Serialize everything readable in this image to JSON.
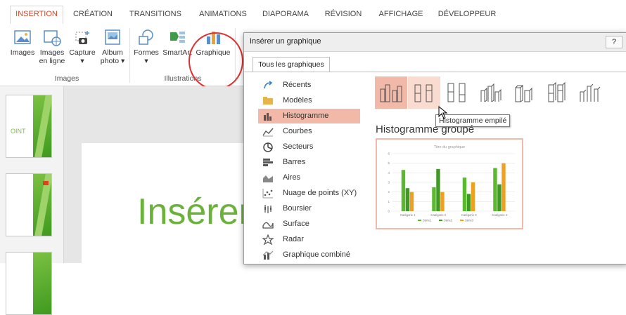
{
  "ribbon_tabs": [
    "INSERTION",
    "CRÉATION",
    "TRANSITIONS",
    "ANIMATIONS",
    "DIAPORAMA",
    "RÉVISION",
    "AFFICHAGE",
    "DÉVELOPPEUR"
  ],
  "ribbon": {
    "buttons": {
      "images": "Images",
      "images_online_1": "Images",
      "images_online_2": "en ligne",
      "capture": "Capture",
      "capture_arrow": "▾",
      "album_1": "Album",
      "album_2": "photo ▾",
      "formes": "Formes",
      "formes_arrow": "▾",
      "smartart": "SmartArt",
      "graphique": "Graphique"
    },
    "groups": {
      "images": "Images",
      "illustrations": "Illustrations"
    }
  },
  "slide": {
    "title": "Insérer"
  },
  "thumbnail": {
    "text1": "OINT",
    "text2": ""
  },
  "dialog": {
    "title": "Insérer un graphique",
    "help": "?",
    "tab": "Tous les graphiques",
    "categories": [
      "Récents",
      "Modèles",
      "Histogramme",
      "Courbes",
      "Secteurs",
      "Barres",
      "Aires",
      "Nuage de points (XY)",
      "Boursier",
      "Surface",
      "Radar",
      "Graphique combiné"
    ],
    "selected_category": "Histogramme",
    "tooltip": "Histogramme empilé",
    "subtitle": "Histogramme groupé",
    "accent": "#f2b9a8"
  },
  "chart_data": {
    "type": "bar",
    "title": "Titre du graphique",
    "categories": [
      "Catégorie 1",
      "Catégorie 2",
      "Catégorie 3",
      "Catégorie 4"
    ],
    "series": [
      {
        "name": "Série1",
        "values": [
          4.3,
          2.5,
          3.5,
          4.5
        ],
        "color": "#5cb82e"
      },
      {
        "name": "Série2",
        "values": [
          2.4,
          4.4,
          1.8,
          2.8
        ],
        "color": "#3e9a24"
      },
      {
        "name": "Série3",
        "values": [
          2,
          2,
          3,
          5
        ],
        "color": "#f0a020"
      }
    ],
    "ylim": [
      0,
      6
    ],
    "yticks": [
      "0",
      "1",
      "2",
      "3",
      "4",
      "5",
      "6"
    ],
    "legend": "bottom"
  }
}
